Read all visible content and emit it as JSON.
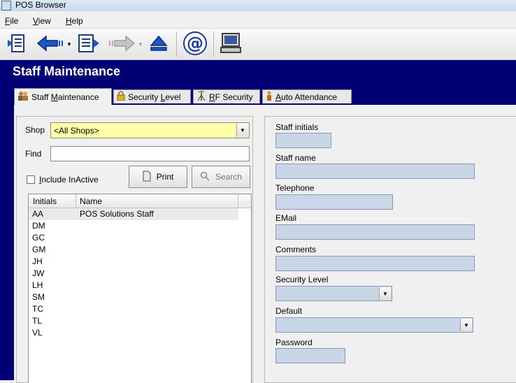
{
  "window": {
    "title": "POS Browser"
  },
  "menu": [
    {
      "label": "File",
      "u": "F",
      "rest": "ile"
    },
    {
      "label": "View",
      "u": "V",
      "rest": "iew"
    },
    {
      "label": "Help",
      "u": "H",
      "rest": "elp"
    }
  ],
  "page": {
    "title": "Staff Maintenance"
  },
  "tabs": [
    {
      "pre": "Staff ",
      "u": "M",
      "post": "aintenance",
      "icon": "staff-icon"
    },
    {
      "pre": "Security ",
      "u": "L",
      "post": "evel",
      "icon": "lock-icon"
    },
    {
      "pre": "",
      "u": "R",
      "post": "F Security",
      "icon": "antenna-icon"
    },
    {
      "pre": "",
      "u": "A",
      "post": "uto Attendance",
      "icon": "person-icon"
    }
  ],
  "filters": {
    "shop_label": "Shop",
    "shop_value": "<All Shops>",
    "find_label": "Find",
    "find_value": "",
    "include_inactive_label": "Include InActive",
    "include_inactive_u": "I",
    "include_inactive_rest": "nclude InActive",
    "print_label": "Print",
    "search_label": "Search"
  },
  "list": {
    "columns": [
      "Initials",
      "Name"
    ],
    "rows": [
      {
        "initials": "AA",
        "name": "POS Solutions Staff"
      },
      {
        "initials": "DM",
        "name": ""
      },
      {
        "initials": "GC",
        "name": ""
      },
      {
        "initials": "GM",
        "name": ""
      },
      {
        "initials": "JH",
        "name": ""
      },
      {
        "initials": "JW",
        "name": ""
      },
      {
        "initials": "LH",
        "name": ""
      },
      {
        "initials": "SM",
        "name": ""
      },
      {
        "initials": "TC",
        "name": ""
      },
      {
        "initials": "TL",
        "name": ""
      },
      {
        "initials": "VL",
        "name": ""
      }
    ]
  },
  "form": {
    "staff_initials_label": "Staff initials",
    "staff_name_label": "Staff name",
    "telephone_label": "Telephone",
    "email_label": "EMail",
    "comments_label": "Comments",
    "security_level_label": "Security Level",
    "default_label": "Default",
    "password_label": "Password"
  },
  "colors": {
    "header_bg": "#000074",
    "field_bg": "#c8d6e8",
    "shop_bg": "#ffffa8"
  }
}
